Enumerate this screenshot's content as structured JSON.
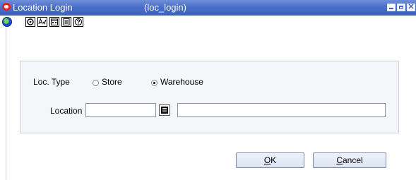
{
  "window": {
    "title": "Location Login",
    "form_code": "(loc_login)"
  },
  "toolbar": {
    "icons": [
      "globe-icon",
      "action-icon",
      "spell-check-icon",
      "calendar-icon",
      "document-icon",
      "help-icon"
    ]
  },
  "form": {
    "loc_type_label": "Loc. Type",
    "options": [
      {
        "label": "Store",
        "selected": false
      },
      {
        "label": "Warehouse",
        "selected": true
      }
    ],
    "location_label": "Location",
    "location_value": "",
    "location_name_value": ""
  },
  "buttons": {
    "ok": {
      "accel": "O",
      "rest": "K"
    },
    "cancel": {
      "accel": "C",
      "rest": "ancel"
    }
  },
  "colors": {
    "titlebar": "#3b5fc0",
    "panel": "#f4f6fa",
    "button": "#dbe4f2"
  }
}
